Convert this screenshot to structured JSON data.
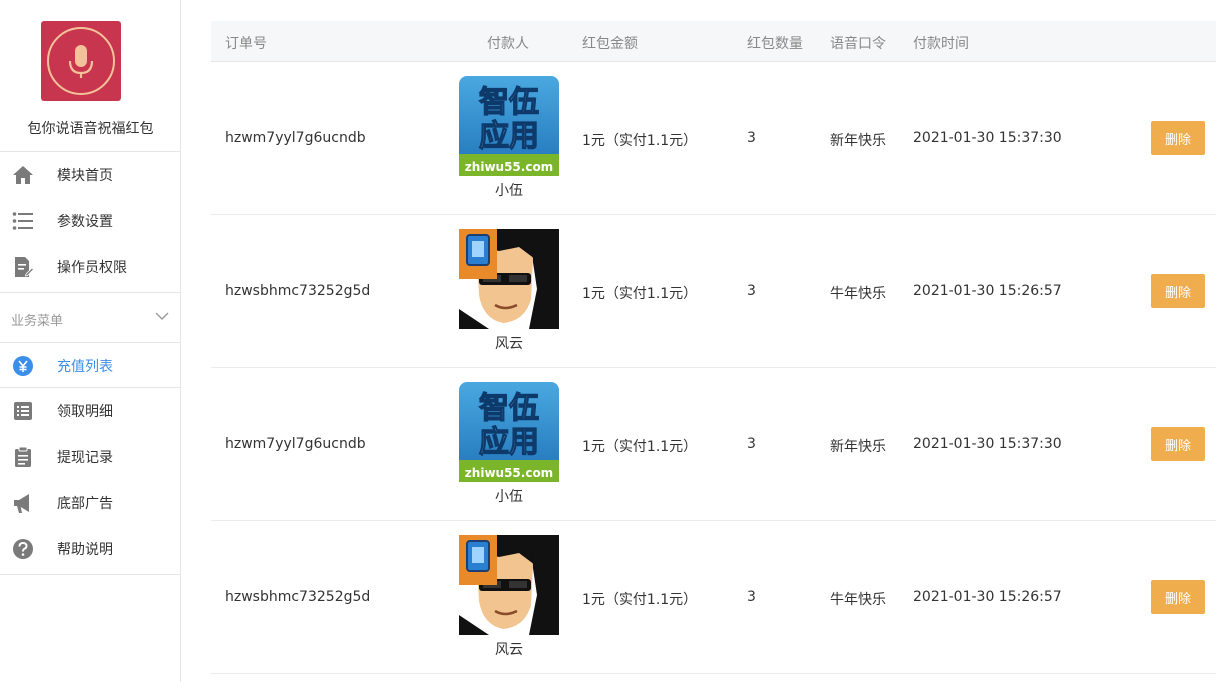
{
  "app": {
    "name": "包你说语音祝福红包"
  },
  "nav_top": [
    {
      "label": "模块首页",
      "icon": "home-icon"
    },
    {
      "label": "参数设置",
      "icon": "list-settings-icon"
    },
    {
      "label": "操作员权限",
      "icon": "document-edit-icon"
    }
  ],
  "section": {
    "label": "业务菜单"
  },
  "nav_active": {
    "label": "充值列表",
    "icon": "yen-coin-icon"
  },
  "nav_bottom": [
    {
      "label": "领取明细",
      "icon": "detail-list-icon"
    },
    {
      "label": "提现记录",
      "icon": "clipboard-icon"
    },
    {
      "label": "底部广告",
      "icon": "megaphone-icon"
    },
    {
      "label": "帮助说明",
      "icon": "help-icon"
    }
  ],
  "table": {
    "headers": [
      "订单号",
      "付款人",
      "红包金额",
      "红包数量",
      "语音口令",
      "付款时间"
    ],
    "delete_label": "删除",
    "rows": [
      {
        "order": "hzwm7yyl7g6ucndb",
        "payer": "小伍",
        "avatar": "zhiwu",
        "amount": "1元（实付1.1元）",
        "count": "3",
        "voice": "新年快乐",
        "time": "2021-01-30 15:37:30"
      },
      {
        "order": "hzwsbhmc73252g5d",
        "payer": "风云",
        "avatar": "cartoon",
        "amount": "1元（实付1.1元）",
        "count": "3",
        "voice": "牛年快乐",
        "time": "2021-01-30 15:26:57"
      },
      {
        "order": "hzwm7yyl7g6ucndb",
        "payer": "小伍",
        "avatar": "zhiwu",
        "amount": "1元（实付1.1元）",
        "count": "3",
        "voice": "新年快乐",
        "time": "2021-01-30 15:37:30"
      },
      {
        "order": "hzwsbhmc73252g5d",
        "payer": "风云",
        "avatar": "cartoon",
        "amount": "1元（实付1.1元）",
        "count": "3",
        "voice": "牛年快乐",
        "time": "2021-01-30 15:26:57"
      }
    ]
  },
  "avatar_text": {
    "zhiwu_top": "智伍",
    "zhiwu_mid": "应用",
    "zhiwu_url": "zhiwu55.com"
  },
  "colors": {
    "accent": "#3b8fe8",
    "delete": "#f0ad4e",
    "logo_bg": "#c8354e"
  }
}
